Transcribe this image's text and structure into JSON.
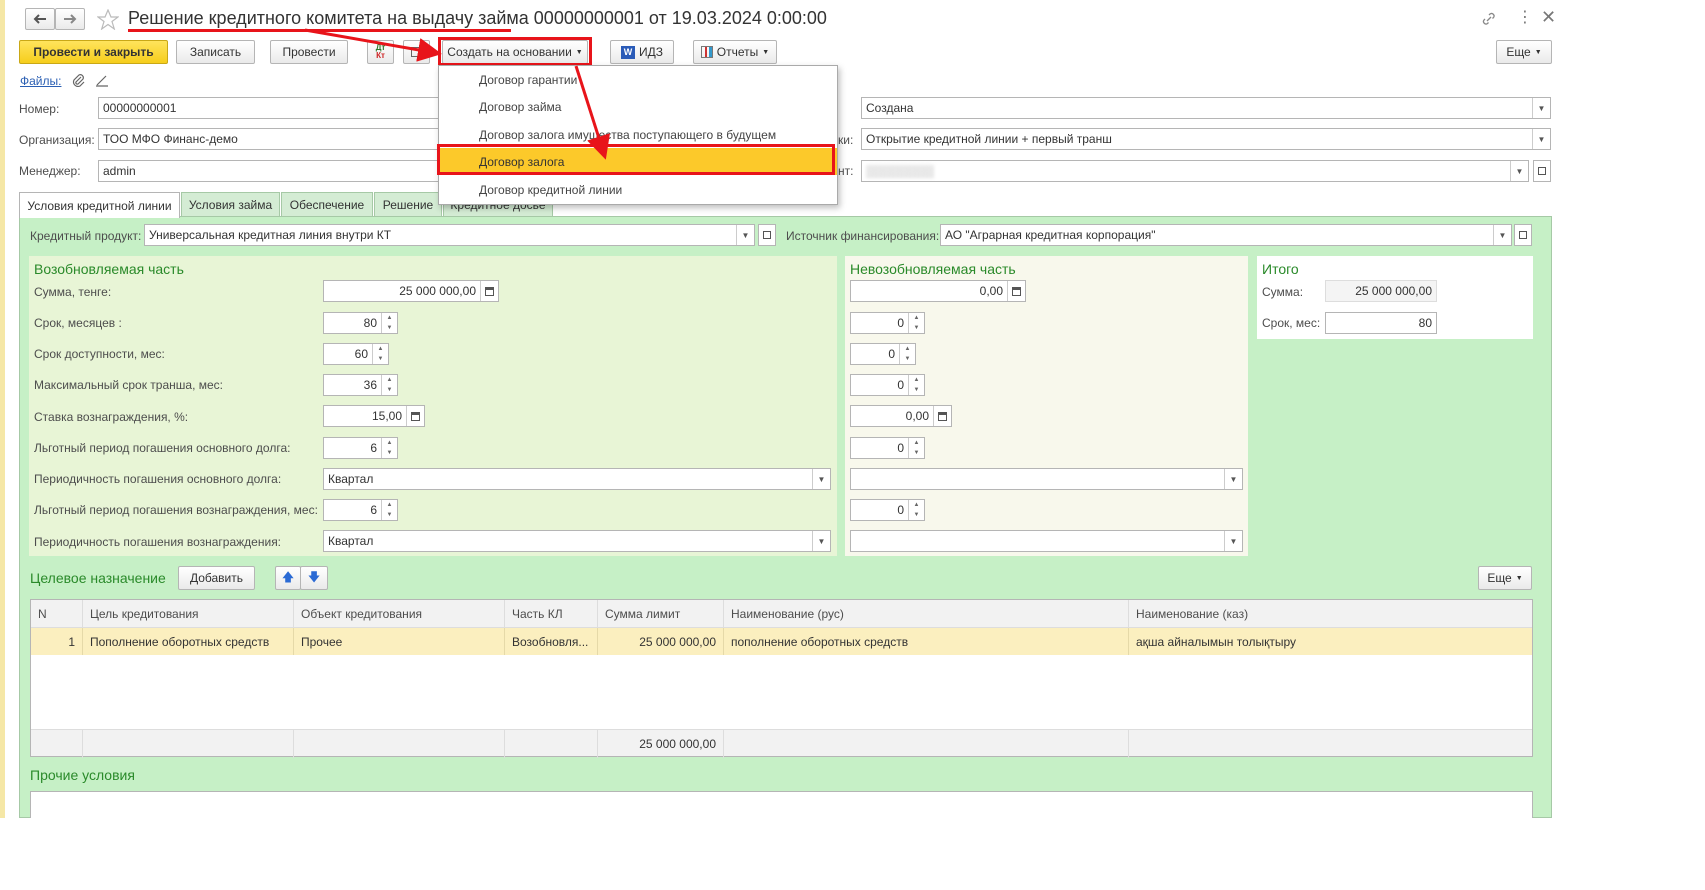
{
  "window": {
    "title": "Решение кредитного комитета на выдачу займа 00000000001 от 19.03.2024 0:00:00"
  },
  "toolbar": {
    "post_close": "Провести и закрыть",
    "save": "Записать",
    "post": "Провести",
    "create_based": "Создать на основании",
    "idz": "ИДЗ",
    "reports": "Отчеты",
    "more": "Еще"
  },
  "files_link": "Файлы:",
  "dropdown_menu": {
    "items": [
      "Договор гарантии",
      "Договор займа",
      "Договор залога имущества поступающего в будущем",
      "Договор залога",
      "Договор кредитной линии"
    ],
    "highlighted_index": 3
  },
  "header_fields": {
    "number_label": "Номер:",
    "number_value": "00000000001",
    "org_label": "Организация:",
    "org_value": "ТОО МФО Финанс-демо",
    "manager_label": "Менеджер:",
    "manager_value": "admin",
    "status_value": "Создана",
    "type_label_tail": "ки:",
    "type_value": "Открытие кредитной линии + первый транш",
    "client_label_tail": "нт:",
    "client_value": "▒▒▒▒▒▒▒▒"
  },
  "tabs": [
    "Условия кредитной линии",
    "Условия займа",
    "Обеспечение",
    "Решение",
    "Кредитное досье"
  ],
  "credit_product": {
    "label": "Кредитный продукт:",
    "value": "Универсальная кредитная линия  внутри КТ",
    "funding_label": "Источник финансирования:",
    "funding_value": "АО \"Аграрная кредитная корпорация\""
  },
  "renewable": {
    "title": "Возобновляемая часть",
    "rows": [
      {
        "label": "Сумма, тенге:",
        "value": "25 000 000,00"
      },
      {
        "label": "Срок, месяцев :",
        "value": "80"
      },
      {
        "label": "Срок доступности, мес:",
        "value": "60"
      },
      {
        "label": "Максимальный срок транша, мес:",
        "value": "36"
      },
      {
        "label": "Ставка вознаграждения, %:",
        "value": "15,00"
      },
      {
        "label": "Льготный период погашения основного долга:",
        "value": "6"
      },
      {
        "label": "Периодичность погашения основного долга:",
        "value": "Квартал"
      },
      {
        "label": "Льготный период погашения вознаграждения, мес:",
        "value": "6"
      },
      {
        "label": "Периодичность погашения вознаграждения:",
        "value": "Квартал"
      }
    ]
  },
  "nonrenewable": {
    "title": "Невозобновляемая часть",
    "values": [
      "0,00",
      "0",
      "0",
      "0",
      "0,00",
      "0",
      "",
      "0",
      ""
    ]
  },
  "total": {
    "title": "Итого",
    "sum_label": "Сумма:",
    "sum_value": "25 000 000,00",
    "term_label": "Срок, мес:",
    "term_value": "80"
  },
  "purpose": {
    "title": "Целевое назначение",
    "add_label": "Добавить",
    "more_label": "Еще",
    "columns": [
      "N",
      "Цель кредитования",
      "Объект кредитования",
      "Часть КЛ",
      "Сумма лимит",
      "Наименование (рус)",
      "Наименование (каз)"
    ],
    "rows": [
      [
        "1",
        "Пополнение оборотных средств",
        "Прочее",
        "Возобновля...",
        "25 000 000,00",
        "пополнение оборотных средств",
        "ақша айналымын толықтыру"
      ]
    ],
    "footer_total": "25 000 000,00"
  },
  "other_conditions": {
    "title": "Прочие условия"
  },
  "colors": {
    "accent_yellow": "#ffd83d",
    "highlight_red": "#e8141a",
    "form_green": "#c6f0c6",
    "renewable_bg": "#e8f5d6",
    "nonrenewable_bg": "#f8f8ec",
    "menu_highlight": "#fcc92a",
    "row_highlight": "#fbefbf"
  }
}
